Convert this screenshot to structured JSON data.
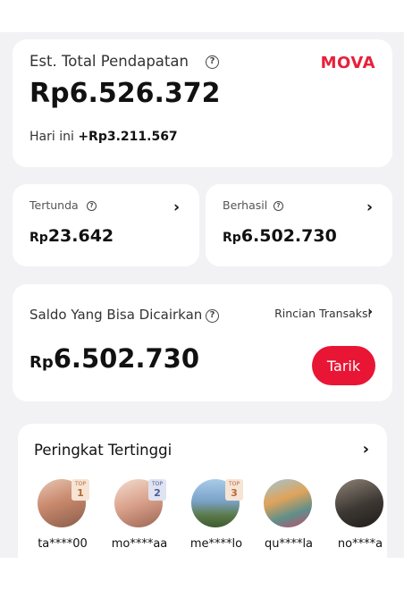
{
  "total_card": {
    "label": "Est. Total Pendapatan",
    "brand": "MOVA",
    "value": "Rp6.526.372",
    "today_label": "Hari ini",
    "today_value": "+Rp3.211.567"
  },
  "pending_card": {
    "label": "Tertunda",
    "rp": "Rp",
    "value": "23.642"
  },
  "success_card": {
    "label": "Berhasil",
    "rp": "Rp",
    "value": "6.502.730"
  },
  "saldo_card": {
    "label": "Saldo Yang Bisa Dicairkan",
    "detail_link": "Rincian Transaksi",
    "rp": "Rp",
    "value": "6.502.730",
    "withdraw_label": "Tarik"
  },
  "ranking": {
    "title": "Peringkat Tertinggi",
    "users": [
      {
        "name": "ta****00",
        "rank_tag": "TOP",
        "rank": "1",
        "avatar_color": "#c98a6e"
      },
      {
        "name": "mo****aa",
        "rank_tag": "TOP",
        "rank": "2",
        "avatar_color": "#d9a08a"
      },
      {
        "name": "me****lo",
        "rank_tag": "TOP",
        "rank": "3",
        "avatar_color": "#7aa3c9"
      },
      {
        "name": "qu****la",
        "avatar_color": "#5f8f8a"
      },
      {
        "name": "no****a",
        "avatar_color": "#3d3833"
      }
    ]
  },
  "colors": {
    "accent": "#e91535",
    "brand": "#e8203a",
    "background": "#f2f2f4"
  },
  "icons": [
    "help-circle-icon",
    "chevron-right-icon"
  ]
}
